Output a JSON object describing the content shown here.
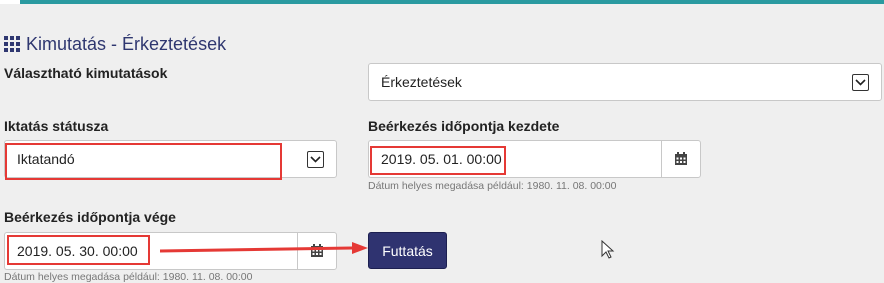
{
  "page": {
    "title": "Kimutatás - Érkeztetések",
    "title_icon": "grid-icon"
  },
  "form": {
    "report_label": "Választható kimutatások",
    "report_value": "Érkeztetések",
    "status_label": "Iktatás státusza",
    "status_value": "Iktatandó",
    "start_label": "Beérkezés időpontja kezdete",
    "start_value": "2019. 05. 01. 00:00",
    "start_hint": "Dátum helyes megadása például: 1980. 11. 08. 00:00",
    "end_label": "Beérkezés időpontja vége",
    "end_value": "2019. 05. 30. 00:00",
    "end_hint": "Dátum helyes megadása például: 1980. 11. 08. 00:00",
    "run_label": "Futtatás"
  },
  "icons": {
    "dropdown": "chevron-down-icon",
    "calendar": "calendar-icon",
    "cursor": "mouse-cursor-icon",
    "annotation": "red-arrow-annotation"
  },
  "colors": {
    "accent": "#2f3370",
    "top_bar": "#2a9aa0",
    "annotation": "#e53935"
  }
}
